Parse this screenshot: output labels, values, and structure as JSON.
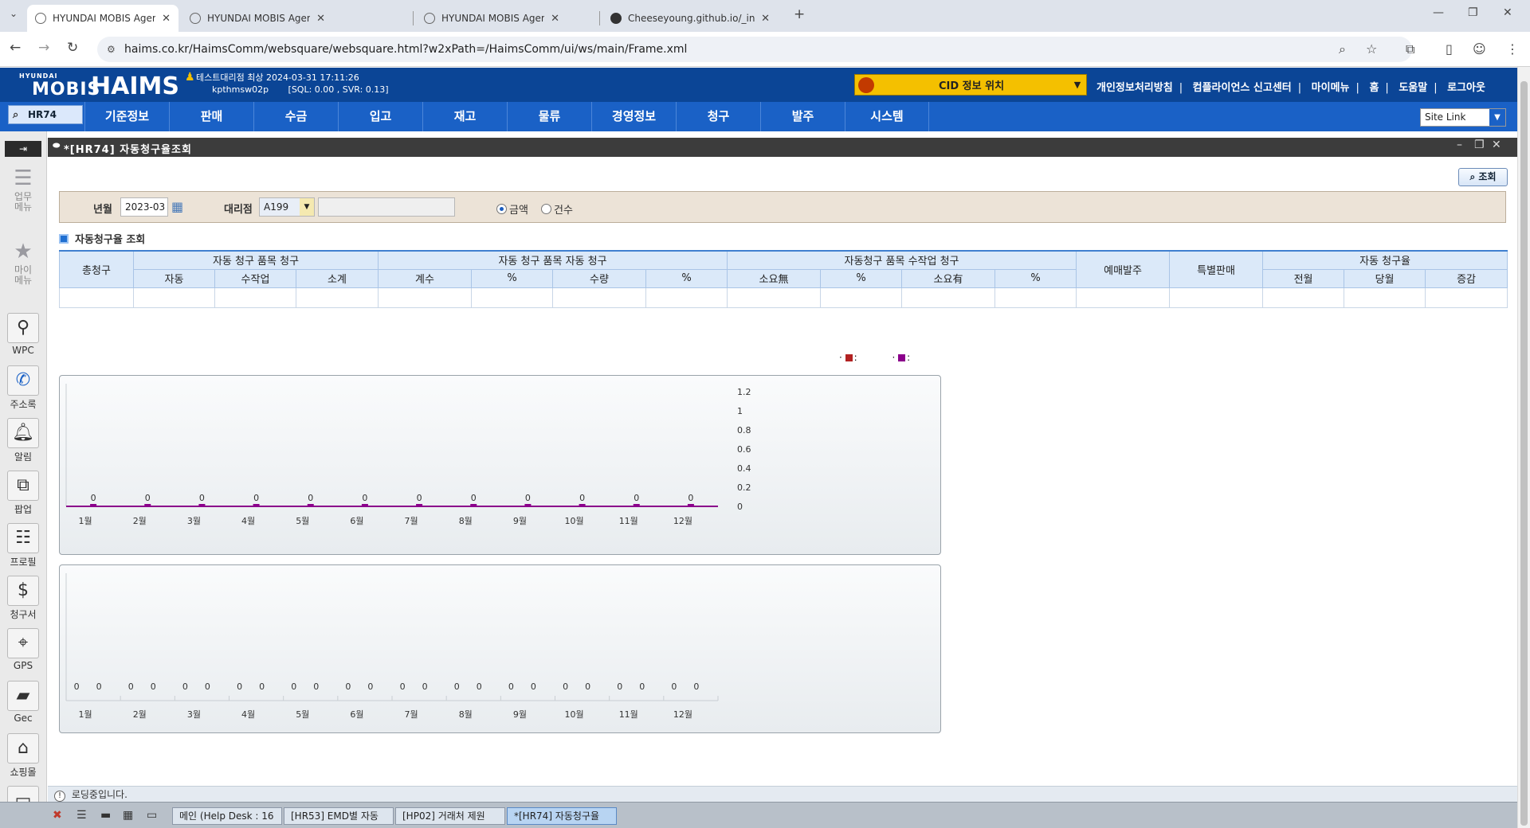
{
  "browser": {
    "tabs": [
      {
        "title": "HYUNDAI MOBIS Agent Inventory",
        "active": true
      },
      {
        "title": "HYUNDAI MOBIS Agent Inventory",
        "active": false
      },
      {
        "title": "HYUNDAI MOBIS Agent Inventory",
        "active": false
      },
      {
        "title": "Cheeseyoung.github.io/_includ",
        "active": false
      }
    ],
    "url": "haims.co.kr/HaimsComm/websquare/websquare.html?w2xPath=/HaimsComm/ui/ws/main/Frame.xml"
  },
  "header": {
    "logo_small": "HYUNDAI",
    "logo_mobis": "MOBIS",
    "logo_haims": "HAIMS",
    "user_line1": "테스트대리점 최상 2024-03-31 17:11:26",
    "user_line2": "kpthmsw02p       [SQL: 0.00 , SVR: 0.13]",
    "cid_label": "CID 정보 위치",
    "links": [
      "개인정보처리방침",
      "컴플라이언스 신고센터",
      "마이메뉴",
      "홈",
      "도움말",
      "로그아웃"
    ]
  },
  "menubar": {
    "search_value": "HR74",
    "items": [
      "기준정보",
      "판매",
      "수금",
      "입고",
      "재고",
      "물류",
      "경영정보",
      "청구",
      "발주",
      "시스템"
    ],
    "site_link": "Site Link"
  },
  "leftbar": {
    "top_items": [
      {
        "label": "업무\n메뉴",
        "icon": "hamburger-icon"
      },
      {
        "label": "마이\n메뉴",
        "icon": "star-icon"
      }
    ],
    "items": [
      {
        "label": "WPC",
        "icon": "wpc-icon"
      },
      {
        "label": "주소록",
        "icon": "phone-icon"
      },
      {
        "label": "알림",
        "icon": "bell-icon"
      },
      {
        "label": "팝업",
        "icon": "popup-icon"
      },
      {
        "label": "프로필",
        "icon": "profile-icon"
      },
      {
        "label": "청구서",
        "icon": "money-bag-icon"
      },
      {
        "label": "GPS",
        "icon": "map-pin-icon"
      },
      {
        "label": "Gec",
        "icon": "book-icon"
      },
      {
        "label": "쇼핑몰",
        "icon": "shop-icon"
      },
      {
        "label": "결제",
        "icon": "card-icon"
      }
    ]
  },
  "window": {
    "title": "*[HR74] 자동청구율조회"
  },
  "filter": {
    "search_button": "조회",
    "month_label": "년월",
    "month_value": "2023-03",
    "dealer_label": "대리점",
    "dealer_value": "A199",
    "dealer_name": "",
    "radio_amount": "금액",
    "radio_count": "건수",
    "selected": "amount"
  },
  "section_title": "자동청구율 조회",
  "grid": {
    "top_headers": [
      {
        "label": "총청구",
        "colspan": 1,
        "rowspan": 2
      },
      {
        "label": "자동 청구 품목 청구",
        "colspan": 3,
        "rowspan": 1
      },
      {
        "label": "자동 청구 품목 자동 청구",
        "colspan": 4,
        "rowspan": 1
      },
      {
        "label": "자동청구 품목 수작업 청구",
        "colspan": 4,
        "rowspan": 1
      },
      {
        "label": "예매발주",
        "colspan": 1,
        "rowspan": 2
      },
      {
        "label": "특별판매",
        "colspan": 1,
        "rowspan": 2
      },
      {
        "label": "자동 청구율",
        "colspan": 3,
        "rowspan": 1
      }
    ],
    "sub_headers": [
      "자동",
      "수작업",
      "소계",
      "계수",
      "%",
      "수량",
      "%",
      "소요無",
      "%",
      "소요有",
      "%",
      "전월",
      "당월",
      "증감"
    ]
  },
  "legend": [
    {
      "label": ":",
      "color": "#b22222"
    },
    {
      "label": ":",
      "color": "#8b008b"
    }
  ],
  "chart_data": [
    {
      "type": "bar",
      "title": "",
      "categories": [
        "1월",
        "2월",
        "3월",
        "4월",
        "5월",
        "6월",
        "7월",
        "8월",
        "9월",
        "10월",
        "11월",
        "12월"
      ],
      "values": [
        0,
        0,
        0,
        0,
        0,
        0,
        0,
        0,
        0,
        0,
        0,
        0
      ],
      "y_ticks": [
        "1.2",
        "1",
        "0.8",
        "0.6",
        "0.4",
        "0.2",
        "0"
      ],
      "ylim": [
        0,
        1.2
      ],
      "y_axis_side": "right"
    },
    {
      "type": "bar",
      "title": "",
      "categories": [
        "1월",
        "2월",
        "3월",
        "4월",
        "5월",
        "6월",
        "7월",
        "8월",
        "9월",
        "10월",
        "11월",
        "12월"
      ],
      "series": [
        {
          "values": [
            0,
            0,
            0,
            0,
            0,
            0,
            0,
            0,
            0,
            0,
            0,
            0
          ]
        },
        {
          "values": [
            0,
            0,
            0,
            0,
            0,
            0,
            0,
            0,
            0,
            0,
            0,
            0
          ]
        }
      ]
    }
  ],
  "status_text": "로딩중입니다.",
  "taskbar": {
    "tabs": [
      "메인 (Help Desk : 16",
      "[HR53] EMD별 자동",
      "[HP02] 거래처 제원",
      "*[HR74] 자동청구율"
    ]
  },
  "colors": {
    "header_bg": "#0b4596",
    "menubar_bg": "#1a61c6",
    "cid_bg": "#f4c000",
    "series1": "#b22222",
    "series2": "#8b008b"
  }
}
